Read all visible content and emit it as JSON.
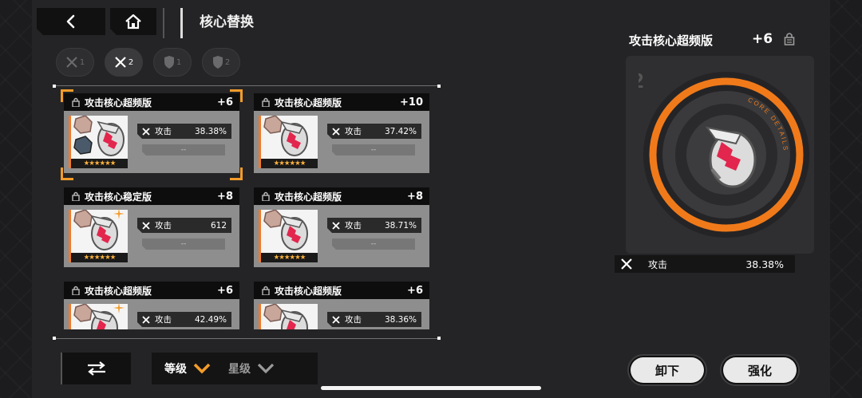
{
  "header": {
    "title": "核心替换",
    "back_icon": "chevron-left-icon",
    "home_icon": "home-icon"
  },
  "filters": [
    {
      "icon": "crossed-swords-icon",
      "label": "1",
      "active": false
    },
    {
      "icon": "crossed-swords-icon",
      "label": "2",
      "active": true
    },
    {
      "icon": "shield-icon",
      "label": "1",
      "active": false
    },
    {
      "icon": "shield-icon",
      "label": "2",
      "active": false
    }
  ],
  "cores": [
    {
      "name": "攻击核心超频版",
      "level": "+6",
      "stat_label": "攻击",
      "stat_value": "38.38%",
      "secondary": "--",
      "stars": "★★★★★★",
      "selected": true
    },
    {
      "name": "攻击核心超频版",
      "level": "+10",
      "stat_label": "攻击",
      "stat_value": "37.42%",
      "secondary": "--",
      "stars": "★★★★★★",
      "selected": false
    },
    {
      "name": "攻击核心稳定版",
      "level": "+8",
      "stat_label": "攻击",
      "stat_value": "612",
      "secondary": "--",
      "stars": "★★★★★★",
      "selected": false
    },
    {
      "name": "攻击核心超频版",
      "level": "+8",
      "stat_label": "攻击",
      "stat_value": "38.71%",
      "secondary": "--",
      "stars": "★★★★★★",
      "selected": false
    },
    {
      "name": "攻击核心超频版",
      "level": "+6",
      "stat_label": "攻击",
      "stat_value": "42.49%",
      "secondary": "--",
      "stars": "★★★★★★",
      "selected": false
    },
    {
      "name": "攻击核心超频版",
      "level": "+6",
      "stat_label": "攻击",
      "stat_value": "38.36%",
      "secondary": "--",
      "stars": "★★★★★★",
      "selected": false
    }
  ],
  "sort": {
    "swap_icon": "swap-arrows-icon",
    "option_level": "等级",
    "option_star": "星级",
    "active": "level"
  },
  "detail": {
    "name": "攻击核心超频版",
    "level": "+6",
    "slot_number": "2",
    "ring_text": "CORE DETAILS",
    "stat_label": "攻击",
    "stat_value": "38.38%"
  },
  "actions": {
    "unequip": "卸下",
    "enhance": "强化"
  },
  "colors": {
    "accent": "#f39c2a",
    "gem_pink": "#e2264d",
    "card_body": "#8e8e8e"
  }
}
